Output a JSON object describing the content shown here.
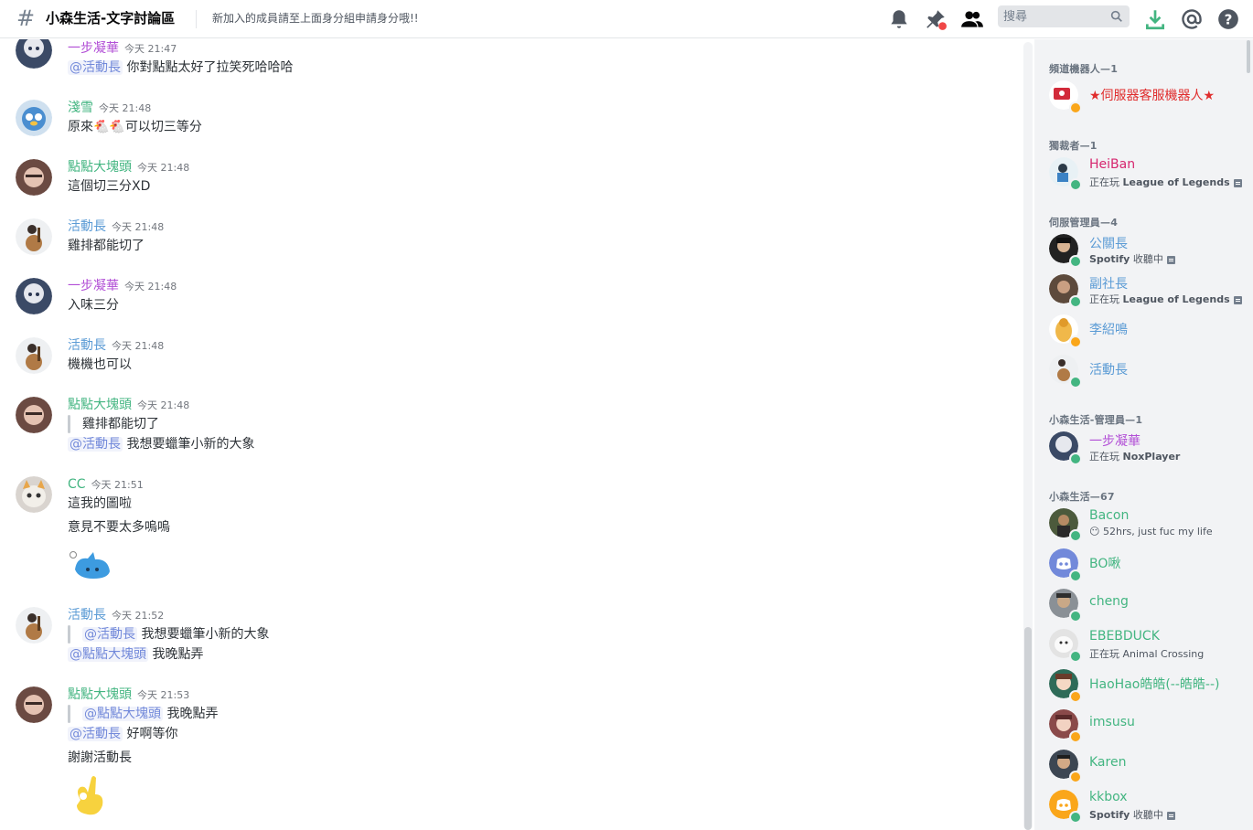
{
  "header": {
    "channel_name": "小森生活-文字討論區",
    "topic": "新加入的成員請至上面身分組申請身分哦!!",
    "search_placeholder": "搜尋"
  },
  "messages": [
    {
      "author": "一步凝華",
      "color": "#b24fd6",
      "time": "今天 21:47",
      "lines": [
        {
          "mention": "@活動長",
          "text": "你對點點太好了拉笑死哈哈哈"
        }
      ]
    },
    {
      "author": "淺雪",
      "color": "#43b581",
      "time": "今天 21:48",
      "lines": [
        {
          "text": "原來🐔🐔可以切三等分"
        }
      ]
    },
    {
      "author": "點點大塊頭",
      "color": "#43b581",
      "time": "今天 21:48",
      "lines": [
        {
          "text": "這個切三分XD"
        }
      ]
    },
    {
      "author": "活動長",
      "color": "#5b9bd5",
      "time": "今天 21:48",
      "lines": [
        {
          "text": "雞排都能切了"
        }
      ]
    },
    {
      "author": "一步凝華",
      "color": "#b24fd6",
      "time": "今天 21:48",
      "lines": [
        {
          "text": "入味三分"
        }
      ]
    },
    {
      "author": "活動長",
      "color": "#5b9bd5",
      "time": "今天 21:48",
      "lines": [
        {
          "text": "機機也可以"
        }
      ]
    },
    {
      "author": "點點大塊頭",
      "color": "#43b581",
      "time": "今天 21:48",
      "quote": {
        "text": "雞排都能切了"
      },
      "lines": [
        {
          "mention": "@活動長",
          "text": "我想要蠟筆小新的大象"
        }
      ]
    },
    {
      "author": "CC",
      "color": "#43b581",
      "time": "今天 21:51",
      "lines": [
        {
          "text": "這我的圖啦"
        },
        {
          "text": "意見不要太多嗚嗚"
        }
      ]
    },
    {
      "author": "活動長",
      "color": "#5b9bd5",
      "time": "今天 21:52",
      "quote": {
        "mention": "@活動長",
        "text": "我想要蠟筆小新的大象"
      },
      "lines": [
        {
          "mention": "@點點大塊頭",
          "text": "我晚點弄"
        }
      ]
    },
    {
      "author": "點點大塊頭",
      "color": "#43b581",
      "time": "今天 21:53",
      "quote": {
        "mention": "@點點大塊頭",
        "text": "我晚點弄"
      },
      "lines": [
        {
          "mention": "@活動長",
          "text": "好啊等你"
        },
        {
          "text": "謝謝活動長"
        }
      ]
    }
  ],
  "groups": [
    {
      "title": "頻道機器人—1"
    },
    {
      "title": "獨裁者—1"
    },
    {
      "title": "伺服管理員—4"
    },
    {
      "title": "小森生活-管理員—1"
    },
    {
      "title": "小森生活—67"
    }
  ],
  "members": [
    {
      "name": "★伺服器客服機器人★",
      "color": "#e02d2d",
      "status": "idle"
    },
    {
      "name": "HeiBan",
      "color": "#d6266e",
      "status": "online",
      "activity_prefix": "正在玩 ",
      "activity": "League of Legends"
    },
    {
      "name": "公關長",
      "color": "#5b9bd5",
      "status": "online",
      "activity_prefix": "",
      "activity": "Spotify",
      "activity_suffix": " 收聽中"
    },
    {
      "name": "副社長",
      "color": "#5b9bd5",
      "status": "online",
      "activity_prefix": "正在玩 ",
      "activity": "League of Legends"
    },
    {
      "name": "李紹鳴",
      "color": "#5b9bd5",
      "status": "idle"
    },
    {
      "name": "活動長",
      "color": "#5b9bd5",
      "status": "online"
    },
    {
      "name": "一步凝華",
      "color": "#b24fd6",
      "status": "online",
      "activity_prefix": "正在玩 ",
      "activity": "NoxPlayer"
    },
    {
      "name": "Bacon",
      "color": "#43b581",
      "status": "online",
      "custom": "52hrs, just fuc my life"
    },
    {
      "name": "BO啾",
      "color": "#43b581",
      "status": "online"
    },
    {
      "name": "cheng",
      "color": "#43b581",
      "status": "online"
    },
    {
      "name": "EBEBDUCK",
      "color": "#43b581",
      "status": "online",
      "activity_prefix": "正在玩 ",
      "activity_plain": "Animal Crossing"
    },
    {
      "name": "HaoHao皓皓(--皓皓--)",
      "color": "#43b581",
      "status": "idle"
    },
    {
      "name": "imsusu",
      "color": "#43b581",
      "status": "idle"
    },
    {
      "name": "Karen",
      "color": "#43b581",
      "status": "idle"
    },
    {
      "name": "kkbox",
      "color": "#43b581",
      "status": "online",
      "activity_prefix": "",
      "activity": "Spotify",
      "activity_suffix": " 收聽中"
    }
  ]
}
